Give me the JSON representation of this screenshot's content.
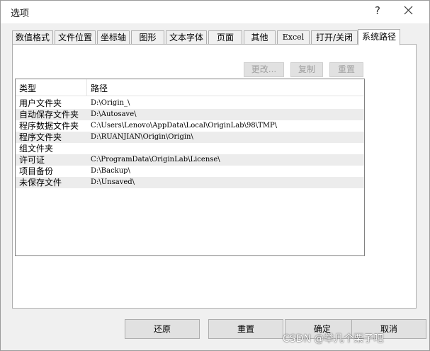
{
  "window": {
    "title": "选项",
    "help_glyph": "?",
    "close_glyph": "✕"
  },
  "tabs": [
    {
      "label": "数值格式"
    },
    {
      "label": "文件位置"
    },
    {
      "label": "坐标轴"
    },
    {
      "label": "图形"
    },
    {
      "label": "文本字体"
    },
    {
      "label": "页面"
    },
    {
      "label": "其他"
    },
    {
      "label": "Excel"
    },
    {
      "label": "打开/关闭"
    },
    {
      "label": "系统路径",
      "active": true
    }
  ],
  "toolbar": {
    "modify_label": "更改...",
    "copy_label": "复制",
    "reset_label": "重置"
  },
  "table": {
    "columns": [
      "类型",
      "路径"
    ],
    "rows": [
      {
        "type": "用户文件夹",
        "path": "D:\\Origin_\\"
      },
      {
        "type": "自动保存文件夹",
        "path": "D:\\Autosave\\"
      },
      {
        "type": "程序数据文件夹",
        "path": "C:\\Users\\Lenovo\\AppData\\Local\\OriginLab\\98\\TMP\\"
      },
      {
        "type": "程序文件夹",
        "path": "D:\\RUANJIAN\\Origin\\Origin\\"
      },
      {
        "type": "组文件夹",
        "path": ""
      },
      {
        "type": "许可证",
        "path": "C:\\ProgramData\\OriginLab\\License\\"
      },
      {
        "type": "项目备份",
        "path": "D:\\Backup\\"
      },
      {
        "type": "未保存文件",
        "path": "D:\\Unsaved\\"
      }
    ]
  },
  "footer": {
    "restore_label": "还原",
    "reset_label": "重置",
    "ok_label": "确定",
    "cancel_label": "取消"
  },
  "watermark": "CSDN @举几个栗子吧"
}
